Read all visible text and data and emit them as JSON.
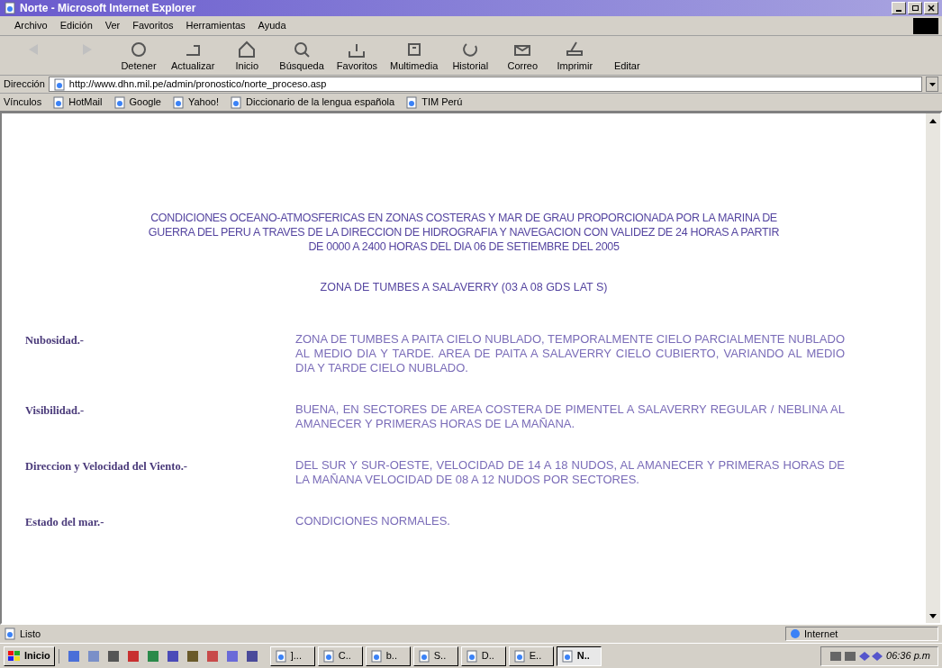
{
  "window": {
    "title": "Norte - Microsoft Internet Explorer"
  },
  "menu": [
    "Archivo",
    "Edición",
    "Ver",
    "Favoritos",
    "Herramientas",
    "Ayuda"
  ],
  "toolbar": [
    {
      "disabled": true,
      "kind": "back"
    },
    {
      "disabled": true,
      "kind": "forward"
    },
    {
      "label": "Detener",
      "disabled": false,
      "kind": "stop"
    },
    {
      "label": "Actualizar",
      "disabled": false,
      "kind": "refresh"
    },
    {
      "label": "Inicio",
      "disabled": false,
      "kind": "home"
    },
    {
      "label": "Búsqueda",
      "disabled": false,
      "kind": "search"
    },
    {
      "label": "Favoritos",
      "disabled": false,
      "kind": "favorites"
    },
    {
      "label": "Multimedia",
      "disabled": false,
      "kind": "media"
    },
    {
      "label": "Historial",
      "disabled": false,
      "kind": "history"
    },
    {
      "label": "Correo",
      "disabled": false,
      "kind": "mail"
    },
    {
      "label": "Imprimir",
      "disabled": false,
      "kind": "print"
    },
    {
      "label": "Editar",
      "disabled": false,
      "kind": "edit"
    }
  ],
  "address": {
    "label": "Dirección",
    "value": "http://www.dhn.mil.pe/admin/pronostico/norte_proceso.asp"
  },
  "links": {
    "label": "Vínculos",
    "items": [
      "HotMail",
      "Google",
      "Yahoo!",
      "Diccionario de la lengua española",
      "TIM Perú"
    ]
  },
  "page": {
    "heading": "CONDICIONES OCEANO-ATMOSFERICAS EN ZONAS COSTERAS Y MAR DE GRAU PROPORCIONADA POR LA MARINA DE GUERRA DEL PERU A TRAVES DE LA DIRECCION DE HIDROGRAFIA Y NAVEGACION CON VALIDEZ DE 24 HORAS A PARTIR DE 0000 A 2400 HORAS DEL DIA 06 DE SETIEMBRE DEL 2005",
    "zone": "ZONA DE TUMBES A SALAVERRY (03 A 08 GDS LAT S)",
    "rows": [
      {
        "label": "Nubosidad.-",
        "text": "ZONA DE TUMBES A PAITA CIELO NUBLADO, TEMPORALMENTE CIELO PARCIALMENTE NUBLADO AL MEDIO DIA Y TARDE. AREA DE PAITA A SALAVERRY CIELO CUBIERTO, VARIANDO AL MEDIO DIA Y TARDE CIELO NUBLADO."
      },
      {
        "label": "Visibilidad.-",
        "text": "BUENA, EN SECTORES DE AREA COSTERA DE PIMENTEL A SALAVERRY REGULAR / NEBLINA AL AMANECER Y PRIMERAS HORAS DE LA MAÑANA."
      },
      {
        "label": "Direccion y Velocidad del Viento.-",
        "text": "DEL SUR Y SUR-OESTE, VELOCIDAD DE 14 A 18 NUDOS, AL AMANECER Y PRIMERAS HORAS DE LA MAÑANA VELOCIDAD DE 08 A 12 NUDOS POR SECTORES."
      },
      {
        "label": "Estado del mar.-",
        "text": "CONDICIONES NORMALES."
      }
    ]
  },
  "status_bar": {
    "text": "Listo",
    "zone": "Internet"
  },
  "taskbar": {
    "start": "Inicio",
    "tasks": [
      {
        "label": "]...",
        "selected": false
      },
      {
        "label": "C..",
        "selected": false
      },
      {
        "label": "b..",
        "selected": false
      },
      {
        "label": "S..",
        "selected": false
      },
      {
        "label": "D..",
        "selected": false
      },
      {
        "label": "E..",
        "selected": false
      },
      {
        "label": "N..",
        "selected": true
      }
    ],
    "clock": "06:36 p.m"
  }
}
